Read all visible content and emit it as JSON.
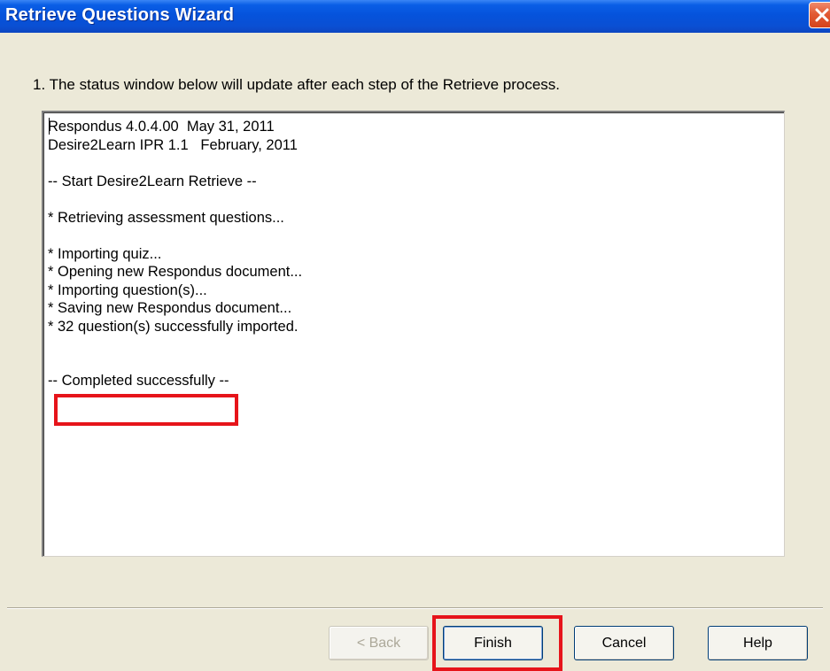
{
  "window": {
    "title": "Retrieve Questions Wizard"
  },
  "instruction": "1.  The status window below will update after each step of the Retrieve process.",
  "status_lines": [
    "Respondus 4.0.4.00  May 31, 2011",
    "Desire2Learn IPR 1.1   February, 2011",
    "",
    "-- Start Desire2Learn Retrieve --",
    "",
    "* Retrieving assessment questions...",
    "",
    "* Importing quiz...",
    "* Opening new Respondus document...",
    "* Importing question(s)...",
    "* Saving new Respondus document...",
    "* 32 question(s) successfully imported.",
    "",
    "",
    "-- Completed successfully --"
  ],
  "buttons": {
    "back": "< Back",
    "finish": "Finish",
    "cancel": "Cancel",
    "help": "Help"
  },
  "colors": {
    "highlight": "#e6141a",
    "titlebar": "#0553dc",
    "dialog_bg": "#ece9d8"
  },
  "icons": {
    "close": "close-icon"
  }
}
